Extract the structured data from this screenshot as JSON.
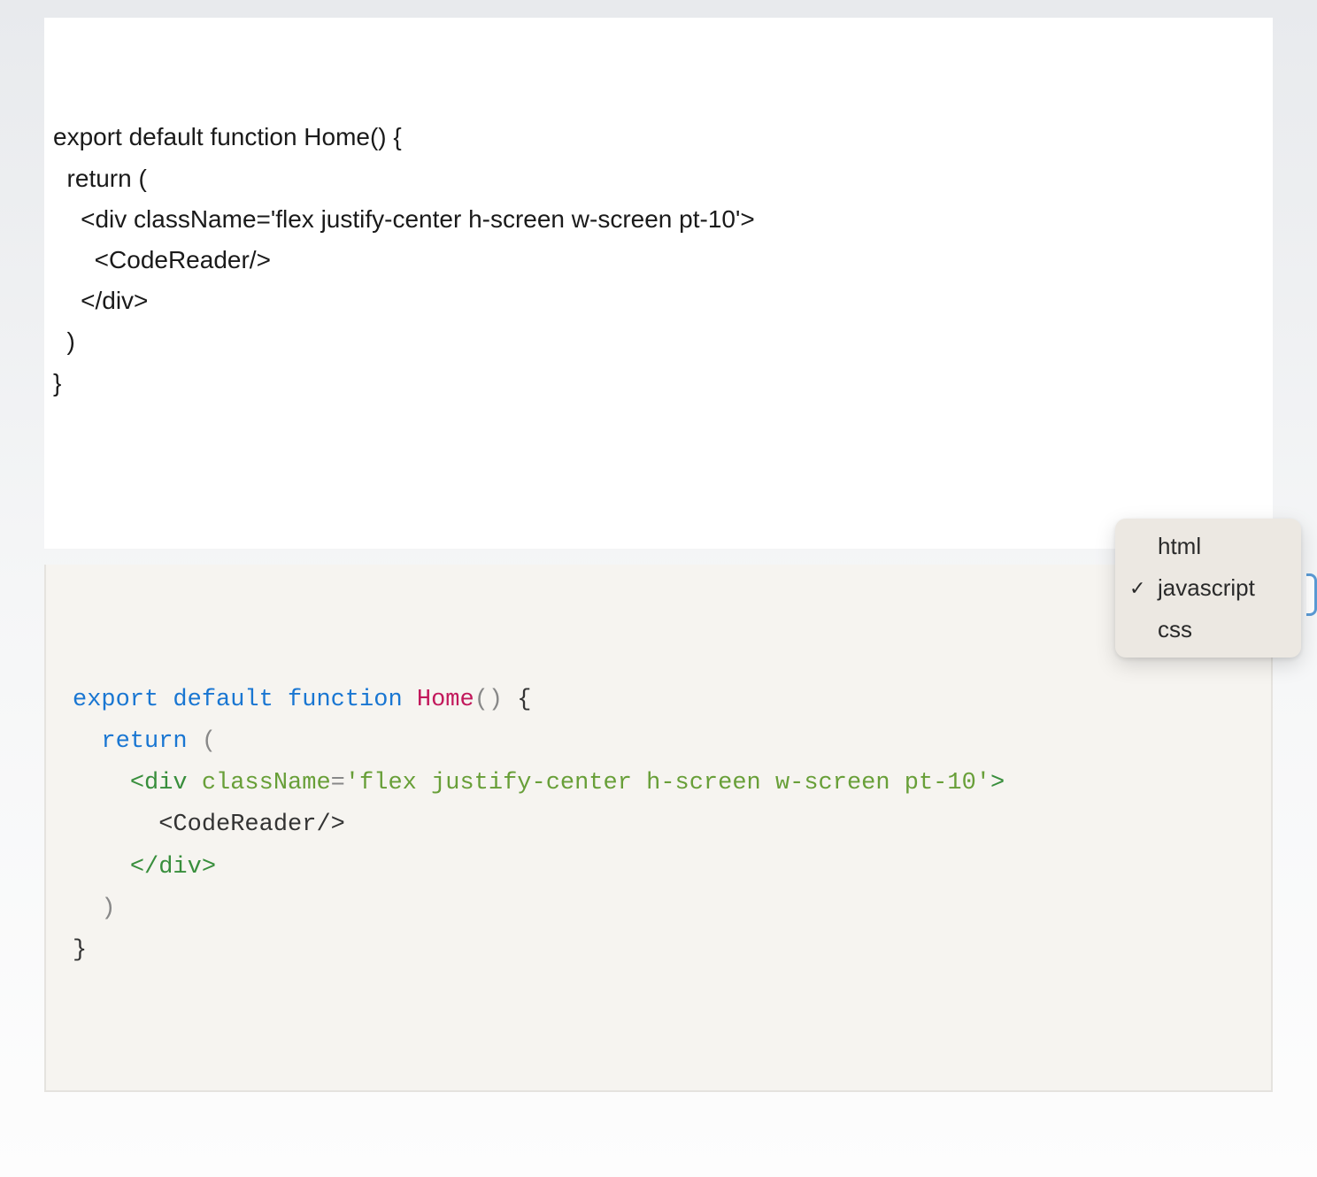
{
  "editor": {
    "lines": [
      "export default function Home() {",
      "  return (",
      "    <div className='flex justify-center h-screen w-screen pt-10'>",
      "      <CodeReader/>",
      "    </div>",
      "  )",
      "}"
    ]
  },
  "preview": {
    "tokens": [
      [
        {
          "t": "keyword",
          "v": "export"
        },
        {
          "t": "space",
          "v": " "
        },
        {
          "t": "keyword",
          "v": "default"
        },
        {
          "t": "space",
          "v": " "
        },
        {
          "t": "keyword",
          "v": "function"
        },
        {
          "t": "space",
          "v": " "
        },
        {
          "t": "fn",
          "v": "Home"
        },
        {
          "t": "punct",
          "v": "()"
        },
        {
          "t": "space",
          "v": " "
        },
        {
          "t": "body",
          "v": "{"
        }
      ],
      [
        {
          "t": "space",
          "v": "  "
        },
        {
          "t": "keyword",
          "v": "return"
        },
        {
          "t": "space",
          "v": " "
        },
        {
          "t": "punct",
          "v": "("
        }
      ],
      [
        {
          "t": "space",
          "v": "    "
        },
        {
          "t": "tag",
          "v": "<div"
        },
        {
          "t": "space",
          "v": " "
        },
        {
          "t": "attr",
          "v": "className"
        },
        {
          "t": "eq",
          "v": "="
        },
        {
          "t": "string",
          "v": "'flex justify-center h-screen w-screen pt-10'"
        },
        {
          "t": "tag",
          "v": ">"
        }
      ],
      [
        {
          "t": "space",
          "v": "      "
        },
        {
          "t": "body",
          "v": "<CodeReader/>"
        }
      ],
      [
        {
          "t": "space",
          "v": "    "
        },
        {
          "t": "tag",
          "v": "</"
        },
        {
          "t": "tag",
          "v": "div"
        },
        {
          "t": "tag",
          "v": ">"
        }
      ],
      [
        {
          "t": "space",
          "v": "  "
        },
        {
          "t": "punct",
          "v": ")"
        }
      ],
      [
        {
          "t": "body",
          "v": "}"
        }
      ]
    ]
  },
  "dropdown": {
    "options": [
      {
        "label": "html",
        "selected": false
      },
      {
        "label": "javascript",
        "selected": true
      },
      {
        "label": "css",
        "selected": false
      }
    ]
  }
}
